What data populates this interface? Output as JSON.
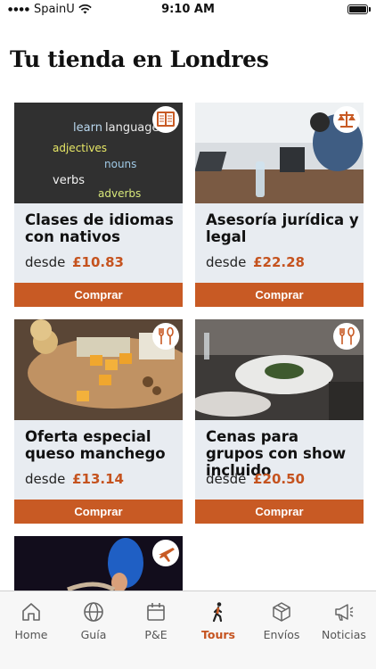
{
  "status_bar": {
    "carrier": "SpainU",
    "time": "9:10 AM"
  },
  "page": {
    "title": "Tu tienda en Londres"
  },
  "colors": {
    "accent": "#c85a24",
    "price": "#c5531f",
    "card_bg": "#e8ecf1"
  },
  "chalkboard_words": [
    "learn",
    "language",
    "adjectives",
    "nouns",
    "verbs",
    "adverbs"
  ],
  "cards": [
    {
      "title": "Clases de idiomas con nativos",
      "price_prefix": "desde",
      "price": "£10.83",
      "button": "Comprar",
      "icon": "book-icon"
    },
    {
      "title": "Asesoría jurídica y legal",
      "price_prefix": "desde",
      "price": "£22.28",
      "button": "Comprar",
      "icon": "scales-icon"
    },
    {
      "title": "Oferta especial queso manchego",
      "price_prefix": "desde",
      "price": "£13.14",
      "button": "Comprar",
      "icon": "fork-spoon-icon"
    },
    {
      "title": "Cenas para grupos con show incluido",
      "price_prefix": "desde",
      "price": "£20.50",
      "button": "Comprar",
      "icon": "fork-spoon-icon"
    },
    {
      "title": "",
      "price_prefix": "",
      "price": "",
      "button": "",
      "icon": "airplane-icon"
    }
  ],
  "tabs": [
    {
      "label": "Home",
      "icon": "home-icon",
      "active": false
    },
    {
      "label": "Guía",
      "icon": "globe-icon",
      "active": false
    },
    {
      "label": "P&E",
      "icon": "calendar-icon",
      "active": false
    },
    {
      "label": "Tours",
      "icon": "walking-person-icon",
      "active": true
    },
    {
      "label": "Envíos",
      "icon": "package-icon",
      "active": false
    },
    {
      "label": "Noticias",
      "icon": "megaphone-icon",
      "active": false
    }
  ]
}
